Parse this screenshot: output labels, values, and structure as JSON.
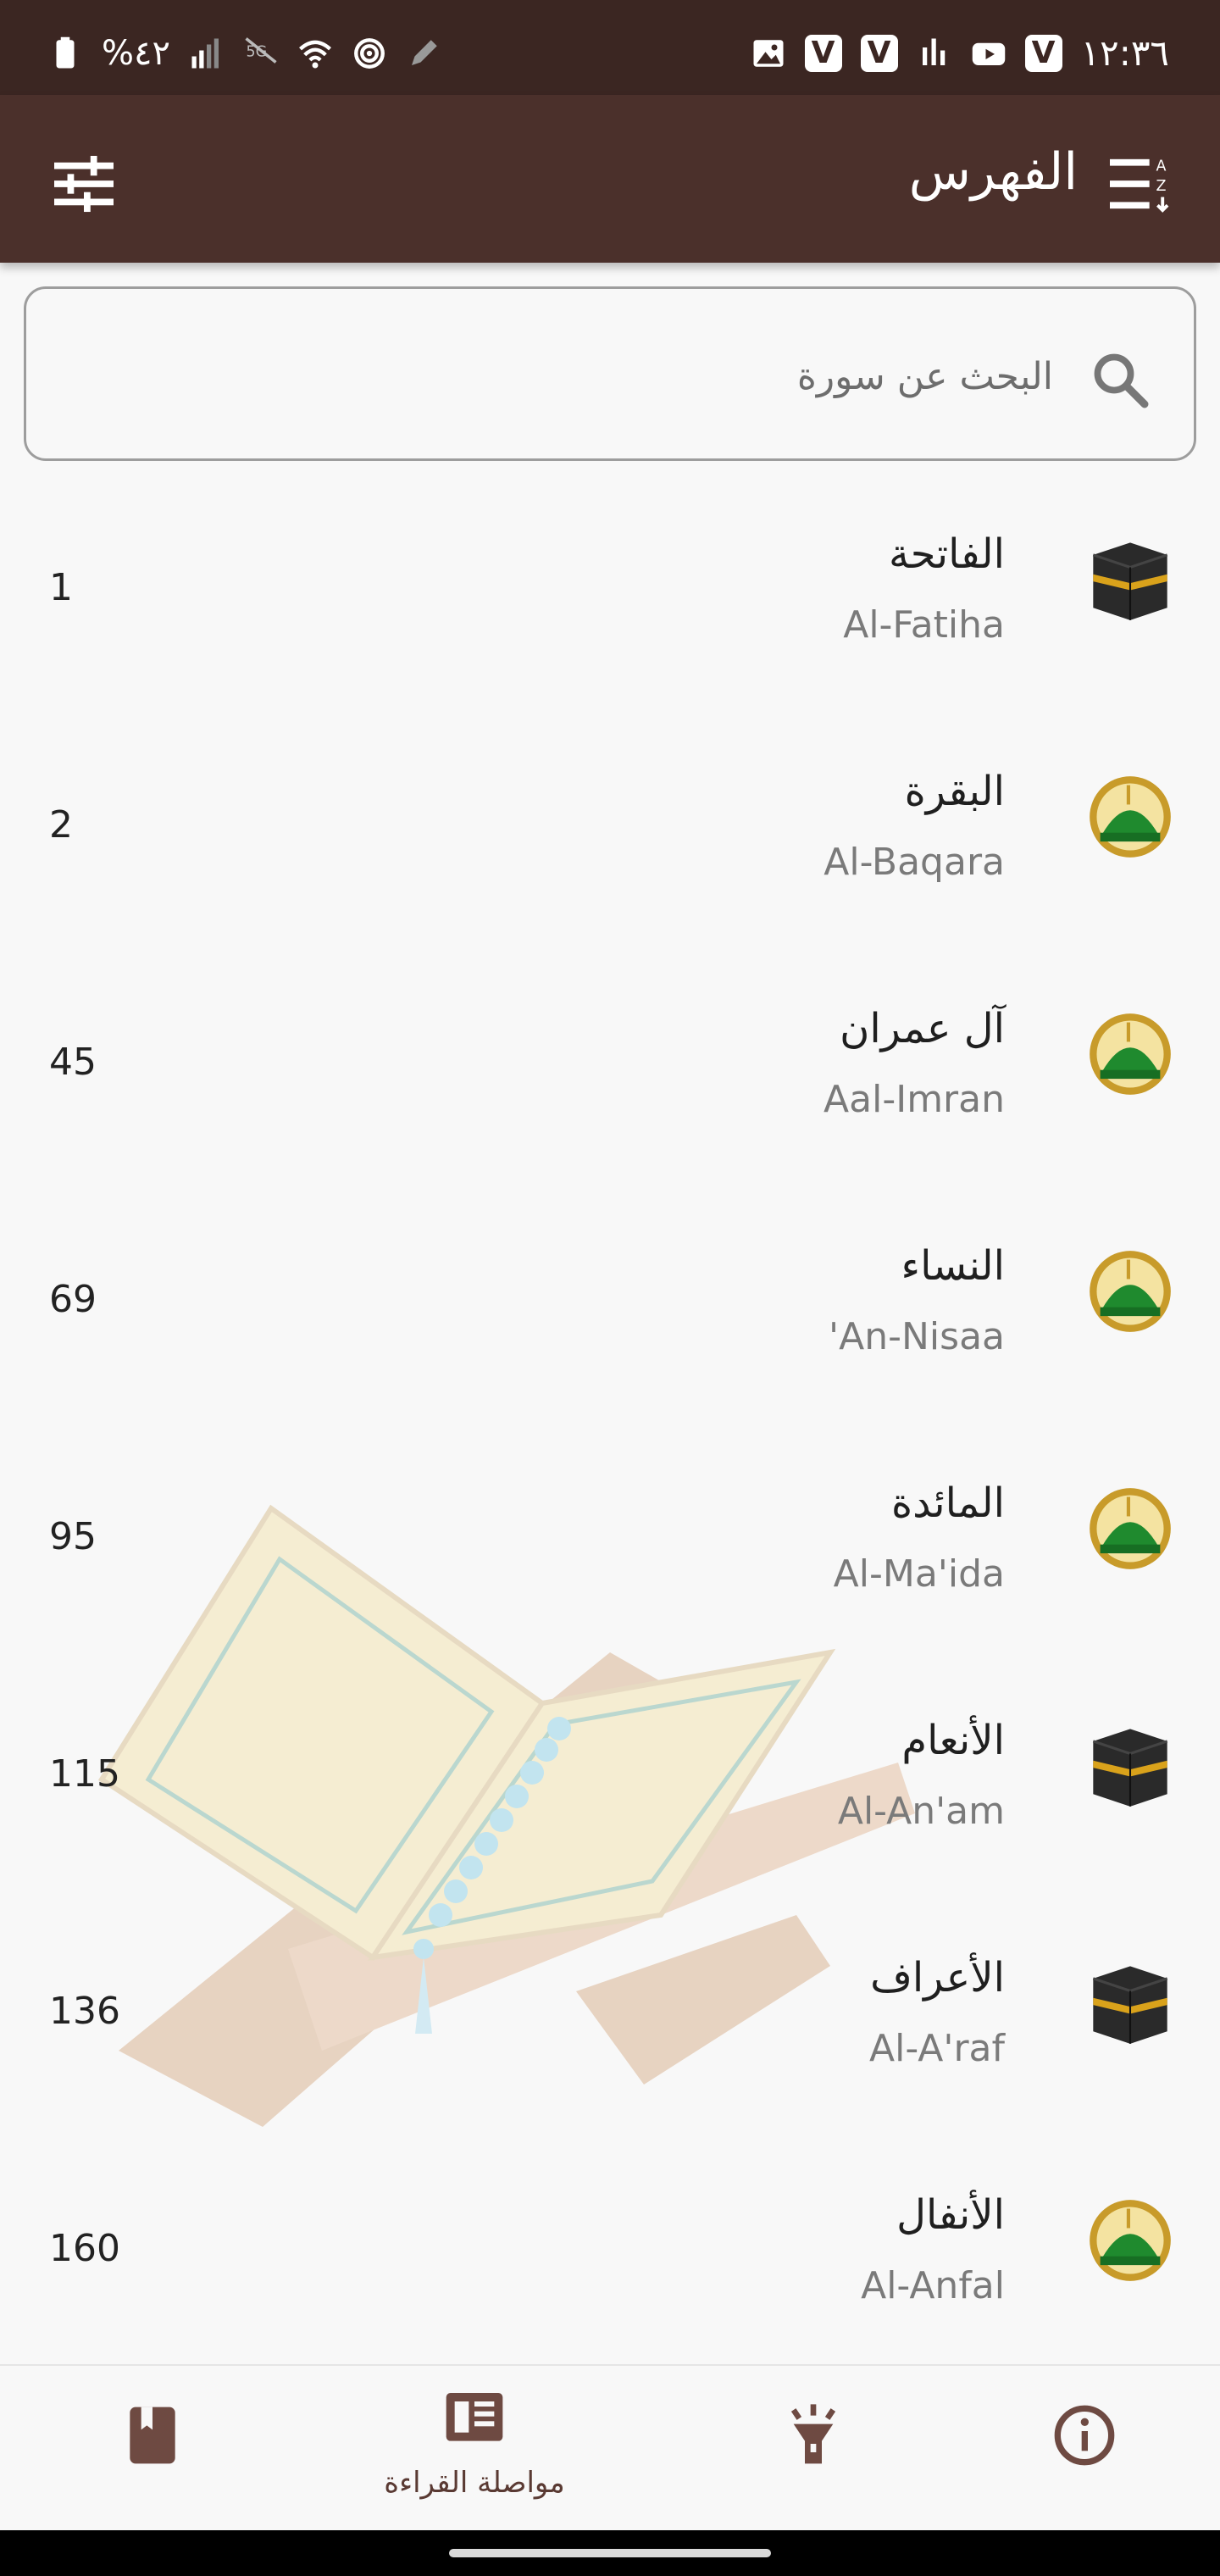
{
  "status_bar": {
    "time": "١٢:٣٦",
    "battery": "%٤٢",
    "colors": {
      "bg": "#3b2622",
      "fg": "#ffffff"
    }
  },
  "app_bar": {
    "title": "الفهرس",
    "menu_icon": "list-index-icon",
    "settings_icon": "tune-icon",
    "bg": "#4b302b"
  },
  "search": {
    "placeholder": "البحث عن سورة",
    "icon": "search-icon"
  },
  "surahs": [
    {
      "ar": "الفاتحة",
      "en": "Al-Fatiha",
      "page": "1",
      "type": "kaaba"
    },
    {
      "ar": "البقرة",
      "en": "Al-Baqara",
      "page": "2",
      "type": "madina"
    },
    {
      "ar": "آل عمران",
      "en": "Aal-Imran",
      "page": "45",
      "type": "madina"
    },
    {
      "ar": "النساء",
      "en": "'An-Nisaa",
      "page": "69",
      "type": "madina"
    },
    {
      "ar": "المائدة",
      "en": "Al-Ma'ida",
      "page": "95",
      "type": "madina"
    },
    {
      "ar": "الأنعام",
      "en": "Al-An'am",
      "page": "115",
      "type": "kaaba"
    },
    {
      "ar": "الأعراف",
      "en": "Al-A'raf",
      "page": "136",
      "type": "kaaba"
    },
    {
      "ar": "الأنفال",
      "en": "Al-Anfal",
      "page": "160",
      "type": "madina"
    }
  ],
  "bottom_nav": {
    "items": [
      {
        "name": "bookmark",
        "label": "",
        "icon": "bookmark-book-icon"
      },
      {
        "name": "continue-reading",
        "label": "مواصلة القراءة",
        "icon": "open-book-icon"
      },
      {
        "name": "torch",
        "label": "",
        "icon": "flashlight-icon"
      },
      {
        "name": "info",
        "label": "",
        "icon": "info-icon"
      }
    ],
    "accent": "#6e4a42"
  }
}
